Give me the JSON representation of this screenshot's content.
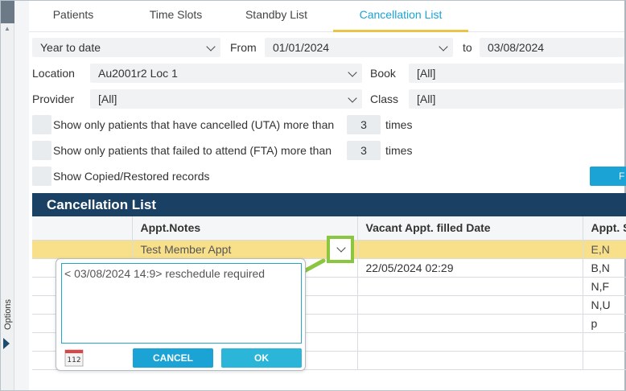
{
  "tabs": [
    "Patients",
    "Time Slots",
    "Standby List",
    "Cancellation List"
  ],
  "filters": {
    "period": "Year to date",
    "from_label": "From",
    "from_date": "01/01/2024",
    "to_label": "to",
    "to_date": "03/08/2024",
    "location_label": "Location",
    "location_value": "Au2001r2 Loc 1",
    "book_label": "Book",
    "book_value": "[All]",
    "provider_label": "Provider",
    "provider_value": "[All]",
    "class_label": "Class",
    "class_value": "[All]"
  },
  "options": {
    "uta_label": "Show only patients that have cancelled (UTA) more than",
    "uta_count": "3",
    "uta_unit": "times",
    "fta_label": "Show only patients that failed to attend (FTA) more than",
    "fta_count": "3",
    "fta_unit": "times",
    "copied_label": "Show Copied/Restored records",
    "blue_button_label": "F"
  },
  "sidebar": {
    "options_label": "Options"
  },
  "grid": {
    "title": "Cancellation List",
    "columns": [
      "",
      "Appt.Notes",
      "Vacant Appt. filled Date",
      "Appt. S"
    ],
    "rows": [
      [
        "",
        "Test Member Appt",
        "",
        "E,N"
      ],
      [
        "",
        "",
        "22/05/2024 02:29",
        "B,N"
      ],
      [
        "",
        "",
        "",
        "N,F"
      ],
      [
        "",
        "",
        "",
        "N,U"
      ],
      [
        "",
        "",
        "",
        "p"
      ],
      [
        "",
        "",
        "",
        ""
      ],
      [
        "",
        "",
        "",
        ""
      ]
    ]
  },
  "popup": {
    "note_text": "< 03/08/2024 14:9> reschedule required",
    "cancel_label": "CANCEL",
    "ok_label": "OK",
    "icon_digits": "112"
  },
  "colors": {
    "accent": "#1aa3d4",
    "header_bar": "#1a4064",
    "selected_row": "#f8e08a",
    "highlight": "#8ac63f",
    "active_tab_underline": "#e8c547"
  }
}
